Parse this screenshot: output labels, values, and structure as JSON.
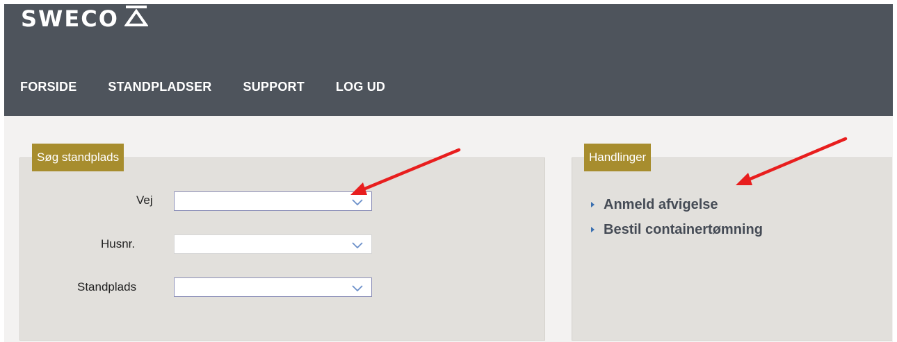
{
  "brand": {
    "name": "SWECO"
  },
  "nav": {
    "items": [
      {
        "label": "FORSIDE"
      },
      {
        "label": "STANDPLADSER"
      },
      {
        "label": "SUPPORT"
      },
      {
        "label": "LOG UD"
      }
    ]
  },
  "search_panel": {
    "title": "Søg standplads",
    "fields": [
      {
        "label": "Vej",
        "value": "",
        "enabled": true
      },
      {
        "label": "Husnr.",
        "value": "",
        "enabled": false
      },
      {
        "label": "Standplads",
        "value": "",
        "enabled": true
      }
    ]
  },
  "actions_panel": {
    "title": "Handlinger",
    "items": [
      {
        "label": "Anmeld afvigelse"
      },
      {
        "label": "Bestil containertømning"
      }
    ]
  },
  "colors": {
    "header_bg": "#4e545c",
    "panel_tag": "#a78d2e",
    "annotation_arrow": "#e81e1e",
    "link_text": "#454b55"
  },
  "icons": [
    "logo-mark-icon",
    "chevron-down-icon",
    "bullet-triangle-icon",
    "annotation-arrow"
  ]
}
